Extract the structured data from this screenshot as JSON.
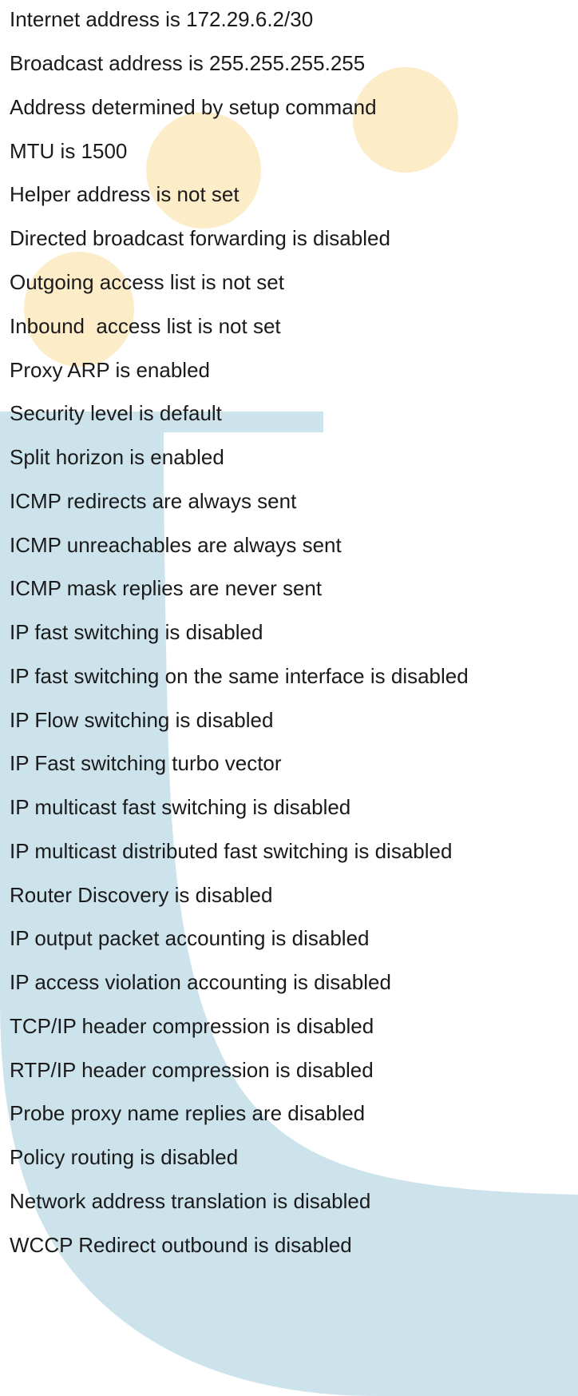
{
  "lines": [
    "Internet address is 172.29.6.2/30",
    "Broadcast address is 255.255.255.255",
    "Address determined by setup command",
    "MTU is 1500",
    "Helper address is not set",
    "Directed broadcast forwarding is disabled",
    "Outgoing access list is not set",
    "Inbound  access list is not set",
    "Proxy ARP is enabled",
    "Security level is default",
    "Split horizon is enabled",
    "ICMP redirects are always sent",
    "ICMP unreachables are always sent",
    "ICMP mask replies are never sent",
    "IP fast switching is disabled",
    "IP fast switching on the same interface is disabled",
    "IP Flow switching is disabled",
    "IP Fast switching turbo vector",
    "IP multicast fast switching is disabled",
    "IP multicast distributed fast switching is disabled",
    "Router Discovery is disabled",
    "IP output packet accounting is disabled",
    "IP access violation accounting is disabled",
    "TCP/IP header compression is disabled",
    "RTP/IP header compression is disabled",
    "Probe proxy name replies are disabled",
    "Policy routing is disabled",
    "Network address translation is disabled",
    "WCCP Redirect outbound is disabled"
  ],
  "colors": {
    "u_shape": "#cde3ec",
    "circles": "#fdecc8",
    "text": "#1a1a1a",
    "background": "#ffffff"
  }
}
